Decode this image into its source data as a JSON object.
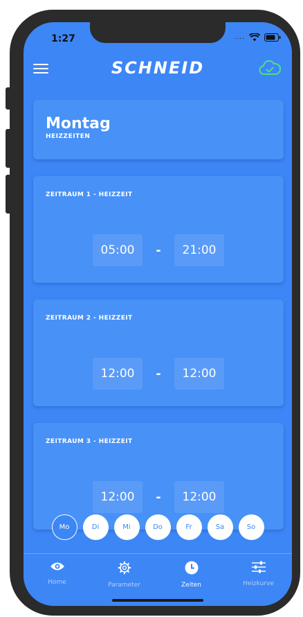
{
  "status_bar": {
    "time": "1:27",
    "signal": "....",
    "icons": [
      "wifi-icon",
      "battery-icon"
    ]
  },
  "header": {
    "brand": "SCHNEID",
    "menu_icon": "hamburger-menu-icon",
    "cloud_icon": "cloud-check-icon"
  },
  "day_card": {
    "title": "Montag",
    "subtitle": "HEIZZEITEN"
  },
  "periods": [
    {
      "label": "ZEITRAUM 1 - HEIZZEIT",
      "start": "05:00",
      "end": "21:00"
    },
    {
      "label": "ZEITRAUM 2 - HEIZZEIT",
      "start": "12:00",
      "end": "12:00"
    },
    {
      "label": "ZEITRAUM 3 - HEIZZEIT",
      "start": "12:00",
      "end": "12:00"
    }
  ],
  "separator": "-",
  "days": [
    {
      "label": "Mo",
      "active": true
    },
    {
      "label": "Di",
      "active": false
    },
    {
      "label": "Mi",
      "active": false
    },
    {
      "label": "Do",
      "active": false
    },
    {
      "label": "Fr",
      "active": false
    },
    {
      "label": "Sa",
      "active": false
    },
    {
      "label": "So",
      "active": false
    }
  ],
  "tabs": [
    {
      "label": "Home",
      "icon": "eye-icon",
      "active": false
    },
    {
      "label": "Parameter",
      "icon": "gear-icon",
      "active": false
    },
    {
      "label": "Zeiten",
      "icon": "clock-icon",
      "active": true
    },
    {
      "label": "Heizkurve",
      "icon": "sliders-icon",
      "active": false
    }
  ],
  "colors": {
    "background": "#3D86F5",
    "card": "#4791F7",
    "time_box": "#5A9BF8",
    "cloud_check": "#4BE08A"
  }
}
